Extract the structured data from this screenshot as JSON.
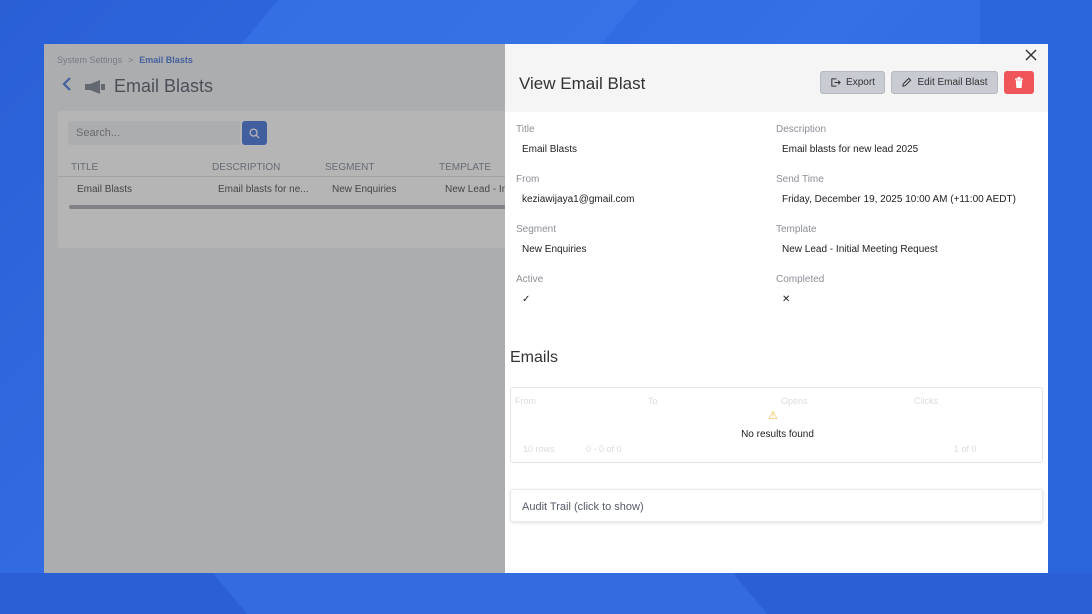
{
  "background_page": {
    "breadcrumb": {
      "parent": "System Settings",
      "separator": ">",
      "current": "Email Blasts"
    },
    "title": "Email Blasts",
    "search_placeholder": "Search...",
    "columns": [
      "TITLE",
      "DESCRIPTION",
      "SEGMENT",
      "TEMPLATE"
    ],
    "rows": [
      {
        "title": "Email Blasts",
        "description": "Email blasts for ne...",
        "segment": "New Enquiries",
        "template": "New Lead - In"
      }
    ]
  },
  "drawer": {
    "title": "View Email Blast",
    "close_icon": "×",
    "buttons": {
      "export": "Export",
      "edit": "Edit Email Blast"
    },
    "fields": {
      "title": {
        "label": "Title",
        "value": "Email Blasts"
      },
      "description": {
        "label": "Description",
        "value": "Email blasts for new lead 2025"
      },
      "from": {
        "label": "From",
        "value": "keziawijaya1@gmail.com"
      },
      "send_time": {
        "label": "Send Time",
        "value": "Friday, December 19, 2025 10:00 AM (+11:00 AEDT)"
      },
      "segment": {
        "label": "Segment",
        "value": "New Enquiries"
      },
      "template": {
        "label": "Template",
        "value": "New Lead - Initial Meeting Request"
      },
      "active": {
        "label": "Active",
        "value": "✓"
      },
      "completed": {
        "label": "Completed",
        "value": "✕"
      }
    },
    "emails": {
      "title": "Emails",
      "columns": [
        "From",
        "To",
        "Opens",
        "Clicks"
      ],
      "warning_icon": "⚠",
      "empty_text": "No results found",
      "rows_select": "10 rows",
      "range_text": "0 - 0 of 0",
      "page_text": "1 of 0"
    },
    "audit_trail": "Audit Trail (click to show)"
  },
  "colors": {
    "accent": "#2d63d8",
    "delete": "#f0555a",
    "frame": "#2a5fd6"
  }
}
